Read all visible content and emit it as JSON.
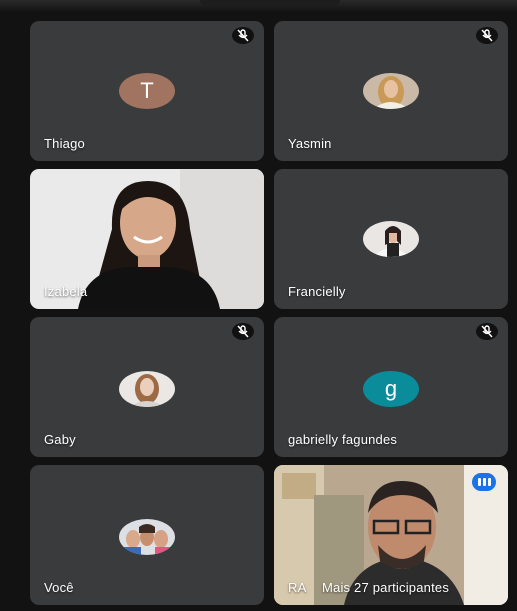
{
  "participants": [
    {
      "name": "Thiago",
      "initial": "T",
      "muted": true
    },
    {
      "name": "Yasmin",
      "muted": true
    },
    {
      "name": "Izabela",
      "muted": false
    },
    {
      "name": "Francielly",
      "muted": false
    },
    {
      "name": "Gaby",
      "muted": true
    },
    {
      "name": "gabrielly fagundes",
      "initial": "g",
      "muted": true
    },
    {
      "name": "Você",
      "muted": false
    },
    {
      "name": "RA",
      "muted": false
    }
  ],
  "more_participants_label": "Mais 27 participantes",
  "colors": {
    "tile_bg": "#3a3b3d",
    "thiago_avatar": "#a07461",
    "gabrielly_avatar": "#0b8c9a",
    "speaking_indicator": "#1a73e8"
  },
  "icons": {
    "muted": "mic-off-icon",
    "speaking": "audio-level-icon"
  }
}
